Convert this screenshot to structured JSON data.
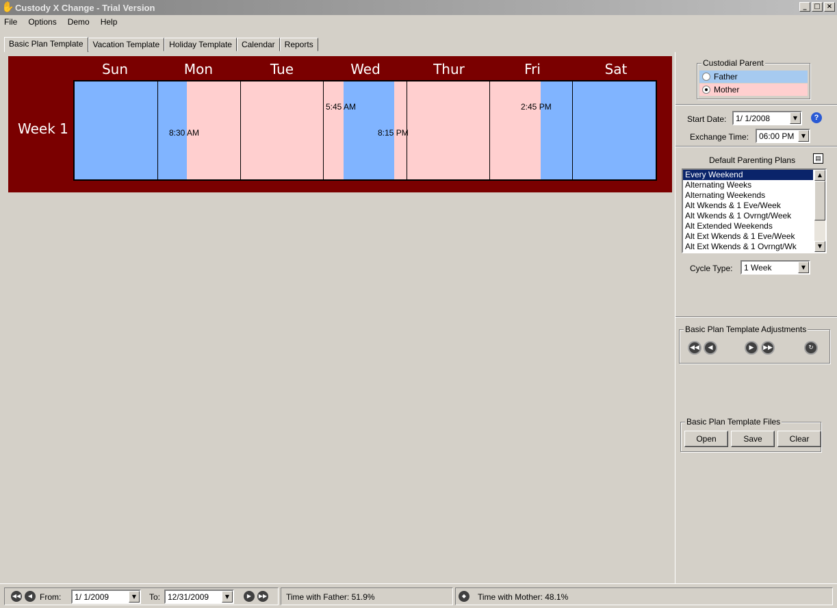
{
  "window": {
    "title": "Custody X Change - Trial Version",
    "controls": [
      "_",
      "□",
      "×"
    ]
  },
  "menu": {
    "items": [
      {
        "label": "File"
      },
      {
        "label": "Options"
      },
      {
        "label": "Demo"
      },
      {
        "label": "Help"
      }
    ]
  },
  "tabs": [
    {
      "label": "Basic Plan Template",
      "active": true
    },
    {
      "label": "Vacation Template"
    },
    {
      "label": "Holiday Template"
    },
    {
      "label": "Calendar"
    },
    {
      "label": "Reports"
    }
  ],
  "plan": {
    "days": [
      "Sun",
      "Mon",
      "Tue",
      "Wed",
      "Thur",
      "Fri",
      "Sat"
    ],
    "week_label": "Week 1",
    "exchanges": {
      "mon": "8:30 AM",
      "wed_start": "5:45 AM",
      "wed_end": "8:15 PM",
      "fri": "2:45 PM"
    },
    "colors": {
      "father": "#80b4ff",
      "mother": "#ffcfcf",
      "panel": "#7a0000"
    }
  },
  "custodial": {
    "legend": "Custodial Parent",
    "father_label": "Father",
    "mother_label": "Mother",
    "selected": "Mother"
  },
  "settings": {
    "start_date_label": "Start Date:",
    "start_date": "1/ 1/2008",
    "exchange_time_label": "Exchange Time:",
    "exchange_time": "06:00 PM"
  },
  "parenting_plans": {
    "title": "Default Parenting Plans",
    "items": [
      "Every Weekend",
      "Alternating Weeks",
      "Alternating Weekends",
      "Alt Wkends & 1 Eve/Week",
      "Alt Wkends & 1 Ovrngt/Week",
      "Alt Extended Weekends",
      "Alt Ext Wkends & 1 Eve/Week",
      "Alt Ext Wkends & 1 Ovrngt/Wk"
    ],
    "selected_index": 0,
    "cycle_type_label": "Cycle Type:",
    "cycle_type": "1 Week"
  },
  "adjustments": {
    "legend": "Basic Plan Template Adjustments"
  },
  "files": {
    "legend": "Basic Plan Template Files",
    "open": "Open",
    "save": "Save",
    "clear": "Clear"
  },
  "status": {
    "from_label": "From:",
    "from_date": "1/ 1/2009",
    "to_label": "To:",
    "to_date": "12/31/2009",
    "father_time": "Time with Father: 51.9%",
    "mother_time": "Time with Mother: 48.1%"
  }
}
